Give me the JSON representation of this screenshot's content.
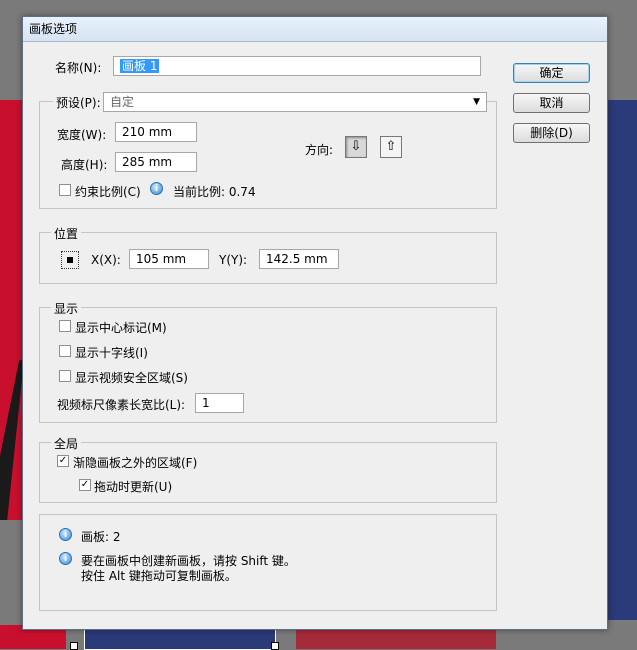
{
  "dialog": {
    "title": "画板选项",
    "name_label": "名称(N):",
    "name_value": "画板 1",
    "preset_group": "预设(P):",
    "preset_value": "自定",
    "width_label": "宽度(W):",
    "width_value": "210 mm",
    "height_label": "高度(H):",
    "height_value": "285 mm",
    "orientation_label": "方向:",
    "constrain_label": "约束比例(C)",
    "ratio_label": "当前比例: 0.74",
    "position_group": "位置",
    "x_label": "X(X):",
    "x_value": "105 mm",
    "y_label": "Y(Y):",
    "y_value": "142.5 mm",
    "display_group": "显示",
    "show_center_mark": "显示中心标记(M)",
    "show_cross_hairs": "显示十字线(I)",
    "show_video_safe": "显示视频安全区域(S)",
    "video_ruler_label": "视频标尺像素长宽比(L):",
    "video_ruler_value": "1",
    "global_group": "全局",
    "fade_region": "渐隐画板之外的区域(F)",
    "update_while_drag": "拖动时更新(U)",
    "info_artboards": "画板: 2",
    "info_line1": "要在画板中创建新画板，请按 Shift 键。",
    "info_line2": "按住 Alt 键拖动可复制画板。"
  },
  "buttons": {
    "ok": "确定",
    "cancel": "取消",
    "delete": "删除(D)"
  },
  "colors": {
    "selection": "#3399ff",
    "artboard_red": "#c8102e",
    "artboard_blue": "#2b3a78"
  }
}
